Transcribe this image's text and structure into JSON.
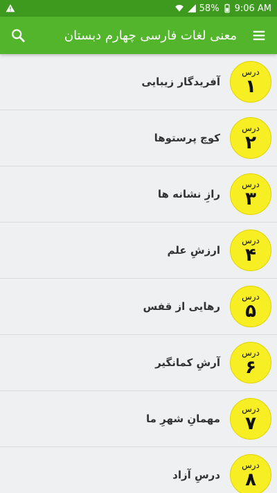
{
  "status_bar": {
    "battery": "58%",
    "time": "9:06 AM"
  },
  "app_bar": {
    "title": "معنی لغات فارسی چهارم دبستان"
  },
  "lessons": [
    {
      "label": "درس",
      "number": "۱",
      "title": "آفریدگار زیبایی"
    },
    {
      "label": "درس",
      "number": "۲",
      "title": "کوچ پرستوها"
    },
    {
      "label": "درس",
      "number": "۳",
      "title": "رازِ نشانه ها"
    },
    {
      "label": "درس",
      "number": "۴",
      "title": "ارزشِ علم"
    },
    {
      "label": "درس",
      "number": "۵",
      "title": "رهایی از قفس"
    },
    {
      "label": "درس",
      "number": "۶",
      "title": "آرشِ کمانگیر"
    },
    {
      "label": "درس",
      "number": "۷",
      "title": "مهمانِ شهرِ ما"
    },
    {
      "label": "درس",
      "number": "۸",
      "title": "درسِ آزاد"
    }
  ],
  "colors": {
    "status_bar": "#3e9a1f",
    "app_bar": "#52b52c",
    "badge": "#f7ee24",
    "list_bg": "#eef0f1"
  }
}
